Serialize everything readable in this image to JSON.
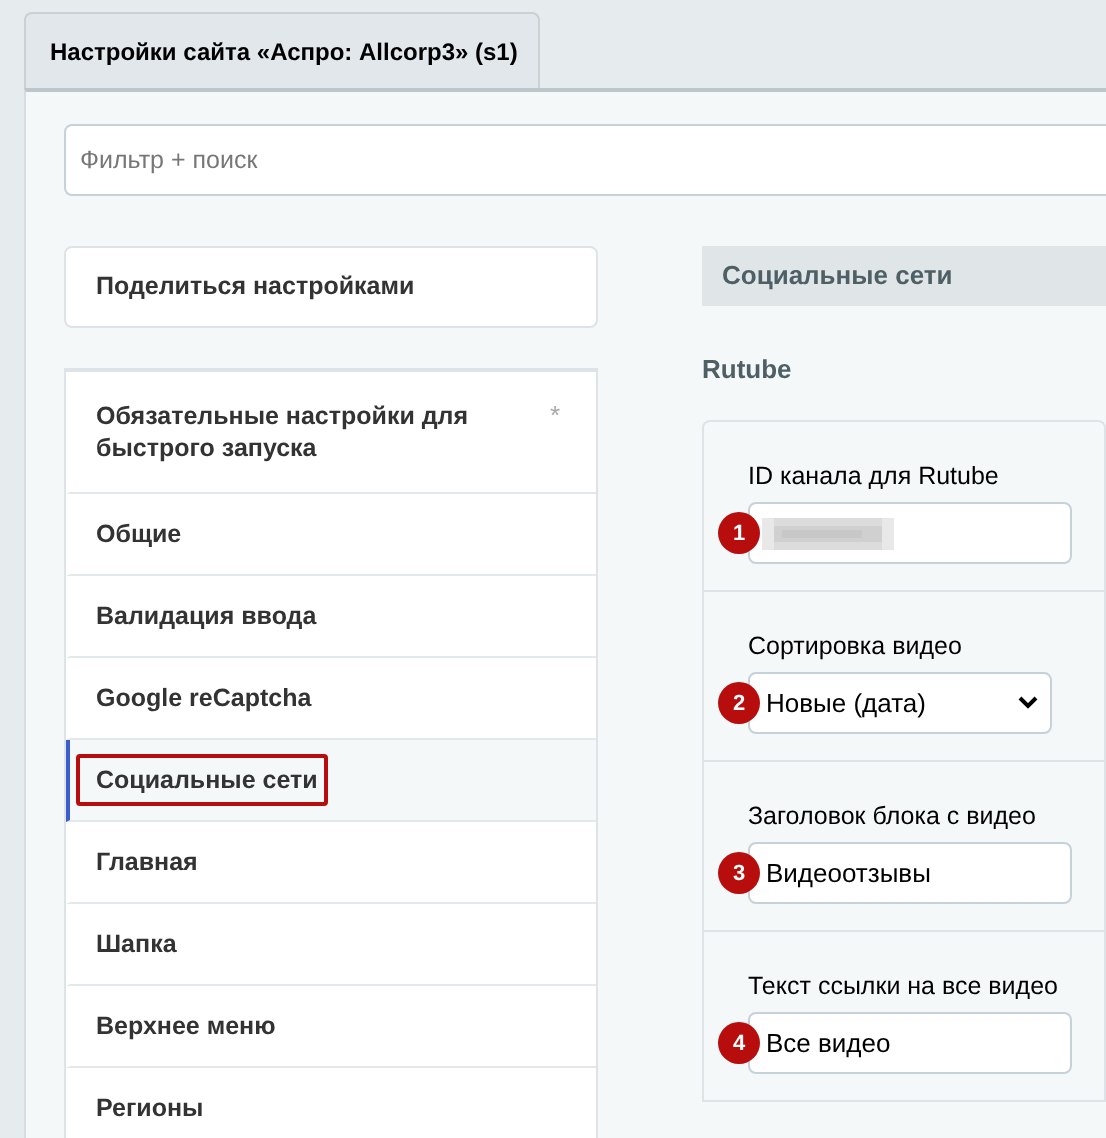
{
  "tab": {
    "label": "Настройки сайта «Аспро: Allcorp3» (s1)",
    "selected": true
  },
  "filter": {
    "placeholder": "Фильтр + поиск"
  },
  "share_button": {
    "label": "Поделиться настройками"
  },
  "menu": [
    {
      "label": "Обязательные настройки для быстрого запуска",
      "required_mark": "*",
      "selected": false,
      "outlined": false
    },
    {
      "label": "Общие",
      "selected": false,
      "outlined": false
    },
    {
      "label": "Валидация ввода",
      "selected": false,
      "outlined": false
    },
    {
      "label": "Google reCaptcha",
      "selected": false,
      "outlined": false
    },
    {
      "label": "Социальные сети",
      "selected": true,
      "outlined": true
    },
    {
      "label": "Главная",
      "selected": false,
      "outlined": false
    },
    {
      "label": "Шапка",
      "selected": false,
      "outlined": false
    },
    {
      "label": "Верхнее меню",
      "selected": false,
      "outlined": false
    },
    {
      "label": "Регионы",
      "selected": false,
      "outlined": false
    }
  ],
  "section": {
    "title": "Социальные сети",
    "group": "Rutube"
  },
  "fields": [
    {
      "marker": "1",
      "label": "ID канала для Rutube",
      "kind": "redacted"
    },
    {
      "marker": "2",
      "label": "Сортировка видео",
      "kind": "select",
      "value": "Новые (дата)"
    },
    {
      "marker": "3",
      "label": "Заголовок блока с видео",
      "kind": "text",
      "value": "Видеоотзывы"
    },
    {
      "marker": "4",
      "label": "Текст ссылки на все видео",
      "kind": "text",
      "value": "Все видео"
    }
  ]
}
